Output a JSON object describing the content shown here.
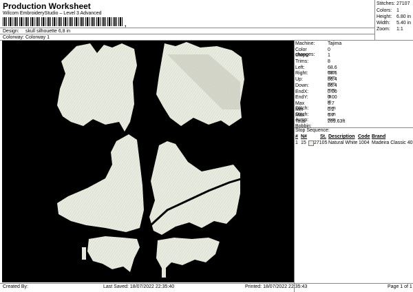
{
  "header": {
    "title": "Production Worksheet",
    "software": "Wilcom EmbroideryStudio – Level 3 Advanced",
    "barcode_mark": ","
  },
  "info": {
    "design_label": "Design:",
    "design_value": "skull silhouette 6,8 in",
    "colorway_label": "Colorway:",
    "colorway_value": "Colorway 1"
  },
  "stats": {
    "stitches_label": "Stitches:",
    "stitches_value": "27107",
    "colors_label": "Colors:",
    "colors_value": "1",
    "height_label": "Height:",
    "height_value": "6.80 in",
    "width_label": "Width:",
    "width_value": "5.40 in",
    "zoom_label": "Zoom:",
    "zoom_value": "1:1"
  },
  "specs": [
    {
      "k": "Machine:",
      "v": "Tajima"
    },
    {
      "k": "Color changes:",
      "v": "0"
    },
    {
      "k": "Stops:",
      "v": "1"
    },
    {
      "k": "Trims:",
      "v": "8"
    },
    {
      "k": "Left:",
      "v": "68.6 mm"
    },
    {
      "k": "Right:",
      "v": "68.6 mm"
    },
    {
      "k": "Up:",
      "v": "86.4 mm"
    },
    {
      "k": "Down:",
      "v": "86.4 mm"
    },
    {
      "k": "EndX:",
      "v": "0.00 in"
    },
    {
      "k": "EndY:",
      "v": "0.00 in"
    },
    {
      "k": "Max Stitch:",
      "v": "6.7 mm"
    },
    {
      "k": "Min Stitch:",
      "v": "0.2 mm"
    },
    {
      "k": "Max Jump:",
      "v": "6.7 mm"
    },
    {
      "k": "Total Bobbin:",
      "v": "209.63ft"
    }
  ],
  "stop_sequence": {
    "title": "Stop Sequence:",
    "headers": {
      "num": "#",
      "n": "N#",
      "st": "St.",
      "desc": "Description",
      "code": "Code",
      "brand": "Brand"
    },
    "rows": [
      {
        "num": "1",
        "n": "15",
        "st": "27105",
        "desc": "Natural White",
        "code": "1004",
        "brand": "Madeira Classic 40",
        "color": "#eef0e6"
      }
    ]
  },
  "footer": {
    "created_by": "Created By:",
    "last_saved": "Last Saved: 18/07/2022 22:35:40",
    "printed": "Printed: 18/07/2022 22:35:43",
    "page": "Page 1 of 1"
  },
  "colors": {
    "canvas_bg": "#000000",
    "thread": "#e9ece0",
    "thread_shade": "#c9cdbf"
  }
}
